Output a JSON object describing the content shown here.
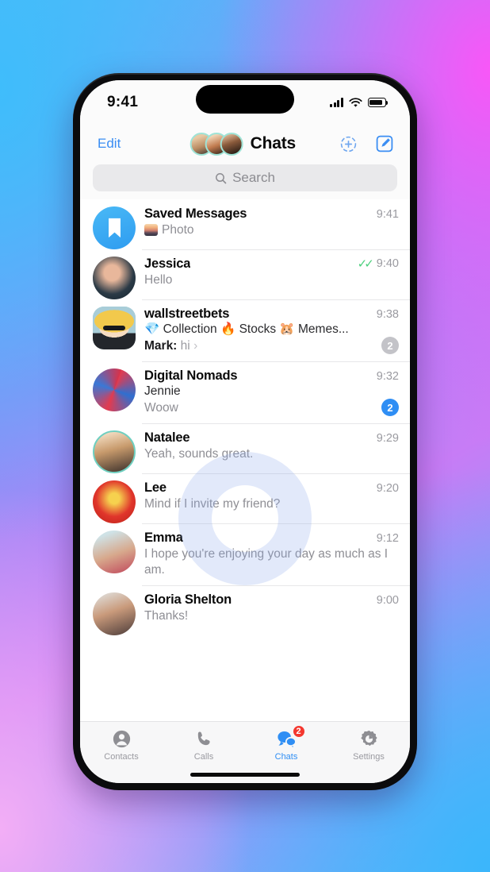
{
  "status_bar": {
    "time": "9:41",
    "signal_icon": "cellular-signal-icon",
    "wifi_icon": "wifi-icon",
    "battery_icon": "battery-icon"
  },
  "navbar": {
    "edit_label": "Edit",
    "title": "Chats",
    "stories_icon": "add-story-icon",
    "compose_icon": "compose-icon",
    "avatar_group": [
      "story-avatar-1",
      "story-avatar-2",
      "story-avatar-3"
    ]
  },
  "search": {
    "placeholder": "Search",
    "icon": "search-icon"
  },
  "chats": [
    {
      "name": "Saved Messages",
      "time": "9:41",
      "preview": "Photo",
      "avatar": "saved-messages-bookmark-icon",
      "has_photo_thumb": true
    },
    {
      "name": "Jessica",
      "time": "9:40",
      "preview": "Hello",
      "read_status": "read-double-check",
      "avatar": "jessica-avatar"
    },
    {
      "name": "wallstreetbets",
      "time": "9:38",
      "topics": "💎 Collection  🔥 Stocks  🐹 Memes...",
      "from_sender": "Mark:",
      "from_text": "hi",
      "from_chevron": "›",
      "badge": "2",
      "badge_style": "muted",
      "avatar": "wallstreetbets-avatar"
    },
    {
      "name": "Digital Nomads",
      "time": "9:32",
      "sender": "Jennie",
      "preview": "Woow",
      "badge": "2",
      "badge_style": "unread",
      "avatar": "digital-nomads-avatar"
    },
    {
      "name": "Natalee",
      "time": "9:29",
      "preview": "Yeah, sounds great.",
      "avatar": "natalee-avatar",
      "has_story_ring": true
    },
    {
      "name": "Lee",
      "time": "9:20",
      "preview": "Mind if I invite my friend?",
      "avatar": "lee-avatar"
    },
    {
      "name": "Emma",
      "time": "9:12",
      "preview": "I hope you're enjoying your day as much as I am.",
      "avatar": "emma-avatar"
    },
    {
      "name": "Gloria Shelton",
      "time": "9:00",
      "preview": "Thanks!",
      "avatar": "gloria-shelton-avatar"
    }
  ],
  "tabbar": {
    "items": [
      {
        "label": "Contacts",
        "icon": "contacts-icon",
        "active": false
      },
      {
        "label": "Calls",
        "icon": "phone-icon",
        "active": false
      },
      {
        "label": "Chats",
        "icon": "chats-icon",
        "active": true,
        "badge": "2"
      },
      {
        "label": "Settings",
        "icon": "gear-icon",
        "active": false
      }
    ]
  },
  "colors": {
    "accent_blue": "#2f8ef4",
    "link_blue": "#3b8ef3",
    "badge_red": "#f4382f",
    "check_green": "#4cd07d",
    "muted_gray": "#c3c3c8"
  }
}
